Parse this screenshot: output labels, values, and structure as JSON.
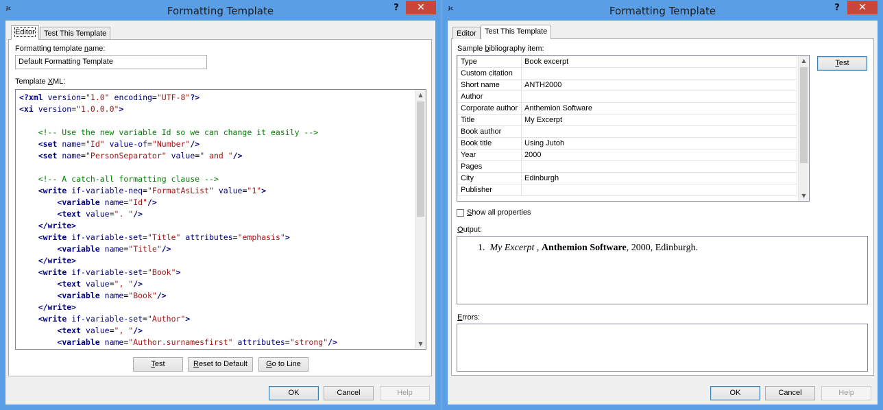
{
  "left": {
    "window_title": "Formatting Template",
    "help_glyph": "?",
    "close_glyph": "✕",
    "app_icon_glyph": "ʲᵋ",
    "tabs": [
      {
        "label": "Editor",
        "active": true
      },
      {
        "label": "Test This Template",
        "active": false
      }
    ],
    "name_label_pre": "Formatting template ",
    "name_label_u": "n",
    "name_label_post": "ame:",
    "name_value": "Default Formatting Template",
    "xml_label_pre": "Template ",
    "xml_label_u": "X",
    "xml_label_post": "ML:",
    "xml_lines": [
      "<?xml version=\"1.0\" encoding=\"UTF-8\"?>",
      "<xi version=\"1.0.0.0\">",
      "",
      "    <!-- Use the new variable Id so we can change it easily -->",
      "    <set name=\"Id\" value-of=\"Number\"/>",
      "    <set name=\"PersonSeparator\" value=\" and \"/>",
      "",
      "    <!-- A catch-all formatting clause -->",
      "    <write if-variable-neq=\"FormatAsList\" value=\"1\">",
      "        <variable name=\"Id\"/>",
      "        <text value=\". \"/>",
      "    </write>",
      "    <write if-variable-set=\"Title\" attributes=\"emphasis\">",
      "        <variable name=\"Title\"/>",
      "    </write>",
      "    <write if-variable-set=\"Book\">",
      "        <text value=\", \"/>",
      "        <variable name=\"Book\"/>",
      "    </write>",
      "    <write if-variable-set=\"Author\">",
      "        <text value=\", \"/>",
      "        <variable name=\"Author.surnamesfirst\" attributes=\"strong\"/>"
    ],
    "buttons": {
      "test_u": "T",
      "test_rest": "est",
      "reset_u": "R",
      "reset_rest": "eset to Default",
      "goto_u": "G",
      "goto_rest": "o to Line"
    },
    "ok": "OK",
    "cancel": "Cancel",
    "help": "Help"
  },
  "right": {
    "window_title": "Formatting Template",
    "help_glyph": "?",
    "close_glyph": "✕",
    "app_icon_glyph": "ʲᵋ",
    "tabs": [
      {
        "label": "Editor",
        "active": false
      },
      {
        "label": "Test This Template",
        "active": true
      }
    ],
    "sample_label_pre": "Sample ",
    "sample_label_u": "b",
    "sample_label_post": "ibliography item:",
    "properties": [
      {
        "name": "Type",
        "value": "Book excerpt"
      },
      {
        "name": "Custom citation",
        "value": ""
      },
      {
        "name": "Short name",
        "value": "ANTH2000"
      },
      {
        "name": "Author",
        "value": ""
      },
      {
        "name": "Corporate author",
        "value": "Anthemion Software"
      },
      {
        "name": "Title",
        "value": "My Excerpt"
      },
      {
        "name": "Book author",
        "value": ""
      },
      {
        "name": "Book title",
        "value": "Using Jutoh"
      },
      {
        "name": "Year",
        "value": "2000"
      },
      {
        "name": "Pages",
        "value": ""
      },
      {
        "name": "City",
        "value": "Edinburgh"
      },
      {
        "name": "Publisher",
        "value": ""
      }
    ],
    "test_u": "T",
    "test_rest": "est",
    "show_all_u": "S",
    "show_all_rest": "how all properties",
    "output_label_pre": "",
    "output_label_u": "O",
    "output_label_post": "utput:",
    "output": {
      "number": "1.",
      "title": "My Excerpt",
      "sep1": " , ",
      "author": "Anthemion Software",
      "rest": ", 2000, Edinburgh."
    },
    "errors_label_pre": "",
    "errors_label_u": "E",
    "errors_label_post": "rrors:",
    "ok": "OK",
    "cancel": "Cancel",
    "help": "Help"
  }
}
